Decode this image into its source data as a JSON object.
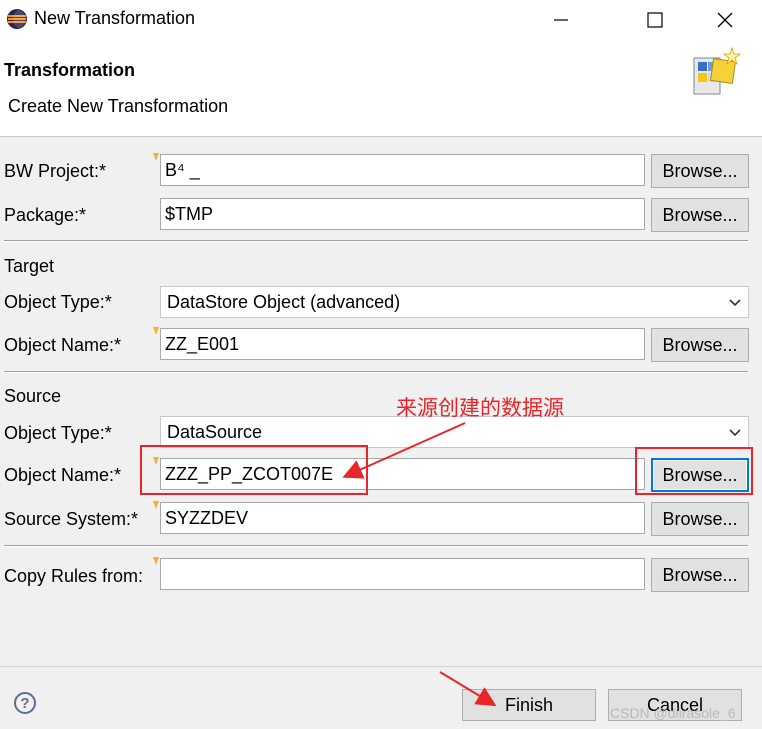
{
  "window": {
    "title": "New Transformation",
    "controls": [
      "minimize",
      "maximize",
      "close"
    ]
  },
  "header": {
    "title": "Transformation",
    "subtitle": "Create New Transformation"
  },
  "form": {
    "bw_project": {
      "label": "BW Project:*",
      "value": "B⁴     _",
      "button": "Browse..."
    },
    "package": {
      "label": "Package:*",
      "value": "$TMP",
      "button": "Browse..."
    },
    "target": {
      "heading": "Target",
      "object_type": {
        "label": "Object Type:*",
        "value": "DataStore Object (advanced)"
      },
      "object_name": {
        "label": "Object Name:*",
        "value": "ZZ_E001",
        "button": "Browse..."
      }
    },
    "source": {
      "heading": "Source",
      "object_type": {
        "label": "Object Type:*",
        "value": "DataSource"
      },
      "object_name": {
        "label": "Object Name:*",
        "value": "ZZZ_PP_ZCOT007E",
        "button": "Browse..."
      },
      "source_system": {
        "label": "Source System:*",
        "value": "SYZZDEV",
        "button": "Browse..."
      }
    },
    "copy_rules": {
      "label": "Copy Rules from:",
      "value": "",
      "button": "Browse..."
    }
  },
  "footer": {
    "help": "?",
    "finish": "Finish",
    "cancel": "Cancel"
  },
  "annotation": {
    "text": "来源创建的数据源",
    "color": "#e8262a"
  },
  "watermark": "CSDN @diirasole_6"
}
